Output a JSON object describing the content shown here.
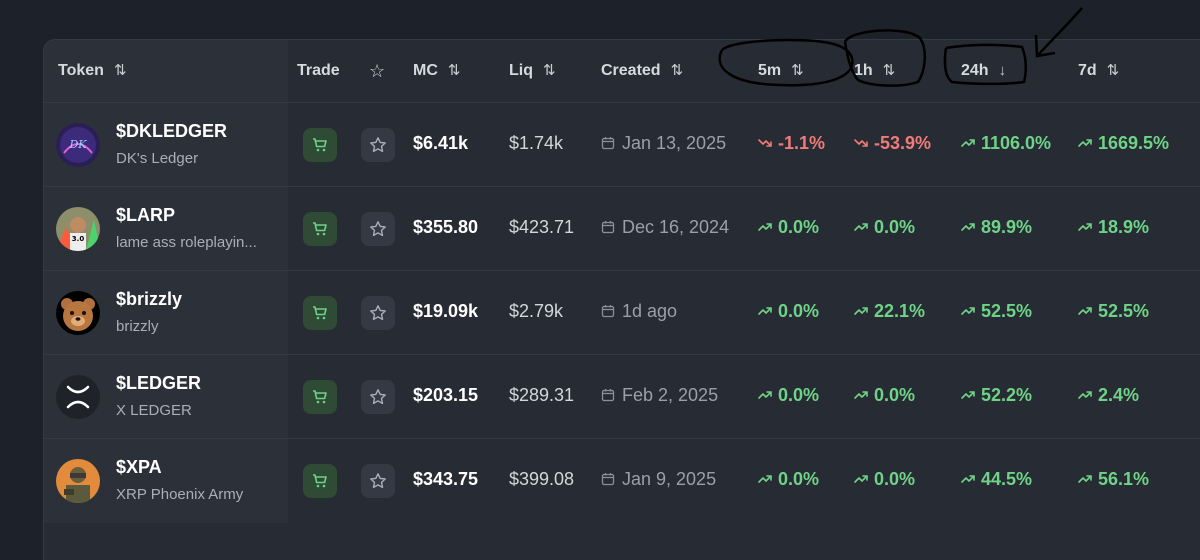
{
  "columns": {
    "token": "Token",
    "trade": "Trade",
    "mc": "MC",
    "liq": "Liq",
    "created": "Created",
    "m5": "5m",
    "h1": "1h",
    "h24": "24h",
    "d7": "7d"
  },
  "sort_icons": {
    "unsorted": "⇅",
    "descending": "↓"
  },
  "sorted_column": "24h",
  "colors": {
    "positive": "#6fd387",
    "negative": "#f07b78",
    "trade_button_bg": "#2f4a35",
    "background": "#1d2129"
  },
  "rows": [
    {
      "symbol": "$DKLEDGER",
      "name": "DK's Ledger",
      "mc": "$6.41k",
      "liq": "$1.74k",
      "created": "Jan 13, 2025",
      "m5": "-1.1%",
      "m5_dir": "down",
      "h1": "-53.9%",
      "h1_dir": "down",
      "h24": "1106.0%",
      "h24_dir": "up",
      "d7": "1669.5%",
      "d7_dir": "up",
      "avatar": "dk-ledger-avatar"
    },
    {
      "symbol": "$LARP",
      "name": "lame ass roleplayin...",
      "mc": "$355.80",
      "liq": "$423.71",
      "created": "Dec 16, 2024",
      "m5": "0.0%",
      "m5_dir": "up",
      "h1": "0.0%",
      "h1_dir": "up",
      "h24": "89.9%",
      "h24_dir": "up",
      "d7": "18.9%",
      "d7_dir": "up",
      "avatar": "larp-avatar"
    },
    {
      "symbol": "$brizzly",
      "name": "brizzly",
      "mc": "$19.09k",
      "liq": "$2.79k",
      "created": "1d ago",
      "m5": "0.0%",
      "m5_dir": "up",
      "h1": "22.1%",
      "h1_dir": "up",
      "h24": "52.5%",
      "h24_dir": "up",
      "d7": "52.5%",
      "d7_dir": "up",
      "avatar": "bear-avatar"
    },
    {
      "symbol": "$LEDGER",
      "name": "X LEDGER",
      "mc": "$203.15",
      "liq": "$289.31",
      "created": "Feb 2, 2025",
      "m5": "0.0%",
      "m5_dir": "up",
      "h1": "0.0%",
      "h1_dir": "up",
      "h24": "52.2%",
      "h24_dir": "up",
      "d7": "2.4%",
      "d7_dir": "up",
      "avatar": "x-logo-avatar"
    },
    {
      "symbol": "$XPA",
      "name": "XRP Phoenix Army",
      "mc": "$343.75",
      "liq": "$399.08",
      "created": "Jan 9, 2025",
      "m5": "0.0%",
      "m5_dir": "up",
      "h1": "0.0%",
      "h1_dir": "up",
      "h24": "44.5%",
      "h24_dir": "up",
      "d7": "56.1%",
      "d7_dir": "up",
      "avatar": "soldier-avatar"
    }
  ]
}
